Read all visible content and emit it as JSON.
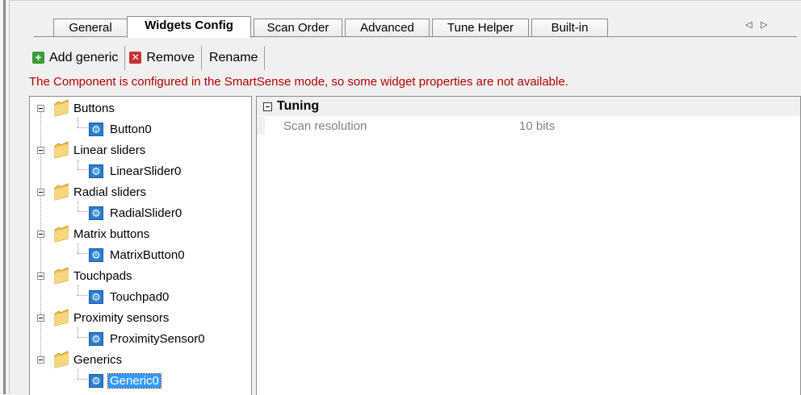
{
  "tabs": [
    {
      "label": "General",
      "active": false
    },
    {
      "label": "Widgets Config",
      "active": true
    },
    {
      "label": "Scan Order",
      "active": false
    },
    {
      "label": "Advanced",
      "active": false
    },
    {
      "label": "Tune Helper",
      "active": false
    },
    {
      "label": "Built-in",
      "active": false
    }
  ],
  "tab_scroll": {
    "left": "◁",
    "right": "▷"
  },
  "toolbar": {
    "add_label": "Add generic",
    "remove_label": "Remove",
    "rename_label": "Rename",
    "add_icon": "plus-icon",
    "remove_icon": "x-icon"
  },
  "notice": "The Component is configured in the SmartSense mode, so some widget properties are not available.",
  "tree": {
    "groups": [
      {
        "label": "Buttons",
        "child": "Button0"
      },
      {
        "label": "Linear sliders",
        "child": "LinearSlider0"
      },
      {
        "label": "Radial sliders",
        "child": "RadialSlider0"
      },
      {
        "label": "Matrix buttons",
        "child": "MatrixButton0"
      },
      {
        "label": "Touchpads",
        "child": "Touchpad0"
      },
      {
        "label": "Proximity sensors",
        "child": "ProximitySensor0"
      },
      {
        "label": "Generics",
        "child": "Generic0"
      }
    ],
    "selected": "Generic0"
  },
  "properties": {
    "category": "Tuning",
    "rows": [
      {
        "name": "Scan resolution",
        "value": "10 bits"
      }
    ]
  },
  "colors": {
    "notice": "#b30000",
    "selection": "#3399ff",
    "folder": "#f2c14e",
    "widget_icon": "#2a7fd0"
  }
}
